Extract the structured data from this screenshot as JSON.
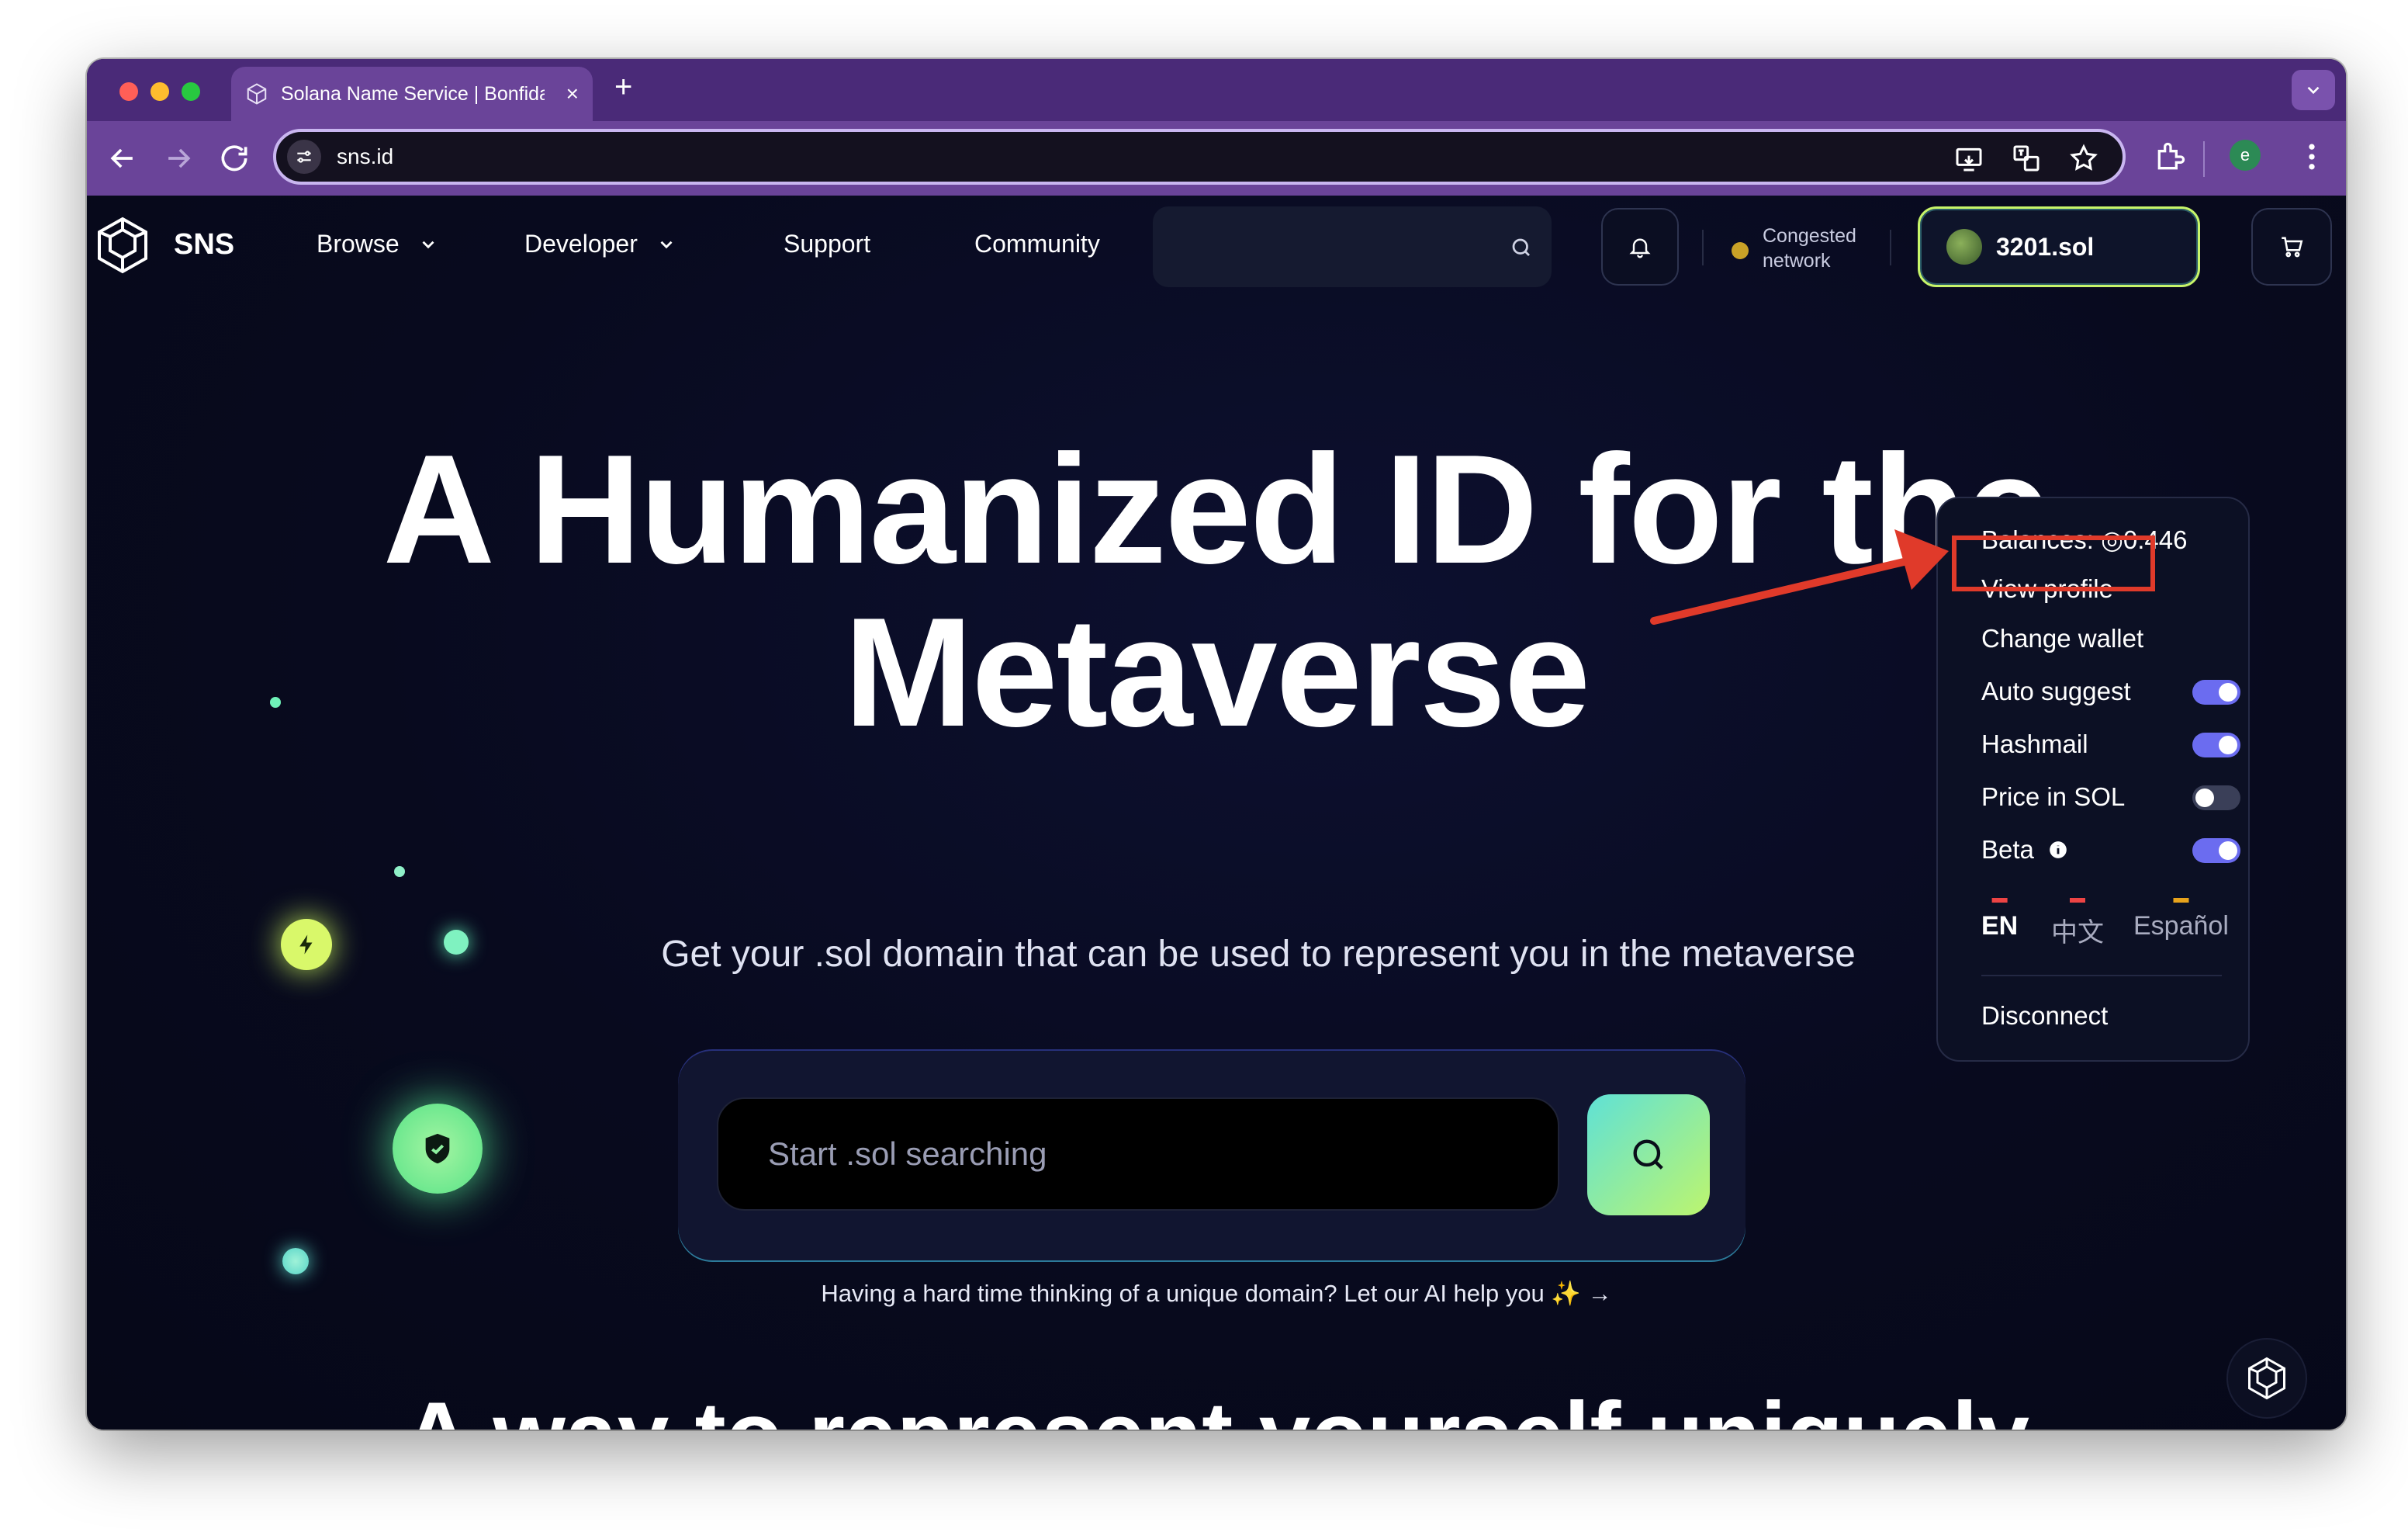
{
  "browser": {
    "tab_title": "Solana Name Service | Bonfida",
    "tab_close": "×",
    "new_tab": "+",
    "url": "sns.id",
    "profile_initial": "e"
  },
  "header": {
    "logo_text": "SNS",
    "nav": [
      {
        "label": "Browse",
        "has_dropdown": true
      },
      {
        "label": "Developer",
        "has_dropdown": true
      },
      {
        "label": "Support",
        "has_dropdown": false
      },
      {
        "label": "Community",
        "has_dropdown": false
      }
    ],
    "network_status": {
      "line1": "Congested",
      "line2": "network",
      "color": "#c9a227"
    },
    "wallet_label": "3201.sol"
  },
  "hero": {
    "title_line1": "A Humanized ID for the",
    "title_line2": "Metaverse",
    "subtitle": "Get your .sol domain that can be used to represent you in the metaverse",
    "search_placeholder": "Start .sol searching",
    "ai_help": "Having a hard time thinking of a unique domain? Let our AI help you ✨ →",
    "next_section_title": "A way to represent yourself uniquely"
  },
  "wallet_menu": {
    "balances": "Balances: ◎0.446",
    "view_profile": "View profile",
    "change_wallet": "Change wallet",
    "toggles": [
      {
        "label": "Auto suggest",
        "on": true
      },
      {
        "label": "Hashmail",
        "on": true
      },
      {
        "label": "Price in SOL",
        "on": false
      },
      {
        "label": "Beta",
        "on": true,
        "info": true
      }
    ],
    "languages": [
      {
        "code": "EN",
        "active": true
      },
      {
        "code": "中文",
        "active": false
      },
      {
        "code": "Español",
        "active": false
      }
    ],
    "disconnect": "Disconnect"
  },
  "colors": {
    "accent_toggle": "#6b6cf0",
    "annotation_red": "#e03a2a",
    "wallet_border": "#c7f56a"
  }
}
